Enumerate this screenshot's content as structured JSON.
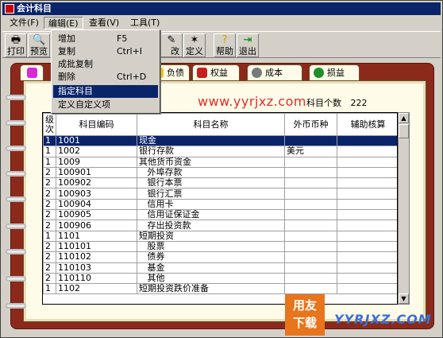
{
  "window": {
    "title": "会计科目"
  },
  "menubar": [
    "文件(F)",
    "编辑(E)",
    "查看(V)",
    "工具(T)"
  ],
  "toolbar": [
    {
      "label": "打印",
      "icon": "printer-icon"
    },
    {
      "label": "预览",
      "icon": "preview-icon"
    },
    {
      "label": "修改",
      "icon": "edit-icon"
    },
    {
      "label": "定义",
      "icon": "define-icon"
    },
    {
      "label": "帮助",
      "icon": "help-icon"
    },
    {
      "label": "退出",
      "icon": "exit-icon"
    }
  ],
  "edit_menu": [
    {
      "label": "增加",
      "shortcut": "F5"
    },
    {
      "label": "复制",
      "shortcut": "Ctrl+I"
    },
    {
      "label": "成批复制",
      "shortcut": ""
    },
    {
      "label": "删除",
      "shortcut": "Ctrl+D"
    },
    {
      "label": "指定科目",
      "shortcut": ""
    },
    {
      "label": "定义自定义项",
      "shortcut": ""
    }
  ],
  "tabs": [
    {
      "label": "",
      "icon": "all-icon"
    },
    {
      "label": "负债",
      "icon": "liability-icon"
    },
    {
      "label": "权益",
      "icon": "equity-icon"
    },
    {
      "label": "成本",
      "icon": "cost-icon"
    },
    {
      "label": "损益",
      "icon": "profit-loss-icon"
    }
  ],
  "page": {
    "title": "科目",
    "count_label": "科目个数",
    "count": "222"
  },
  "watermark": {
    "url": "www.yyrjxz.com",
    "logo_badge": "用友下载",
    "logo_text": "YYRJXZ.COM"
  },
  "table": {
    "headers": [
      "级次",
      "科目编码",
      "科目名称",
      "外币币种",
      "辅助核算"
    ],
    "rows": [
      {
        "level": "1",
        "code": "1001",
        "name": "现金",
        "currency": "",
        "aux": ""
      },
      {
        "level": "1",
        "code": "1002",
        "name": "银行存款",
        "currency": "美元",
        "aux": ""
      },
      {
        "level": "1",
        "code": "1009",
        "name": "其他货币资金",
        "currency": "",
        "aux": ""
      },
      {
        "level": "2",
        "code": "100901",
        "name": "   外埠存款",
        "currency": "",
        "aux": ""
      },
      {
        "level": "2",
        "code": "100902",
        "name": "   银行本票",
        "currency": "",
        "aux": ""
      },
      {
        "level": "2",
        "code": "100903",
        "name": "   银行汇票",
        "currency": "",
        "aux": ""
      },
      {
        "level": "2",
        "code": "100904",
        "name": "   信用卡",
        "currency": "",
        "aux": ""
      },
      {
        "level": "2",
        "code": "100905",
        "name": "   信用证保证金",
        "currency": "",
        "aux": ""
      },
      {
        "level": "2",
        "code": "100906",
        "name": "   存出投资款",
        "currency": "",
        "aux": ""
      },
      {
        "level": "1",
        "code": "1101",
        "name": "短期投资",
        "currency": "",
        "aux": ""
      },
      {
        "level": "2",
        "code": "110101",
        "name": "   股票",
        "currency": "",
        "aux": ""
      },
      {
        "level": "2",
        "code": "110102",
        "name": "   债券",
        "currency": "",
        "aux": ""
      },
      {
        "level": "2",
        "code": "110103",
        "name": "   基金",
        "currency": "",
        "aux": ""
      },
      {
        "level": "2",
        "code": "110110",
        "name": "   其他",
        "currency": "",
        "aux": ""
      },
      {
        "level": "1",
        "code": "1102",
        "name": "短期投资跌价准备",
        "currency": "",
        "aux": ""
      }
    ]
  }
}
